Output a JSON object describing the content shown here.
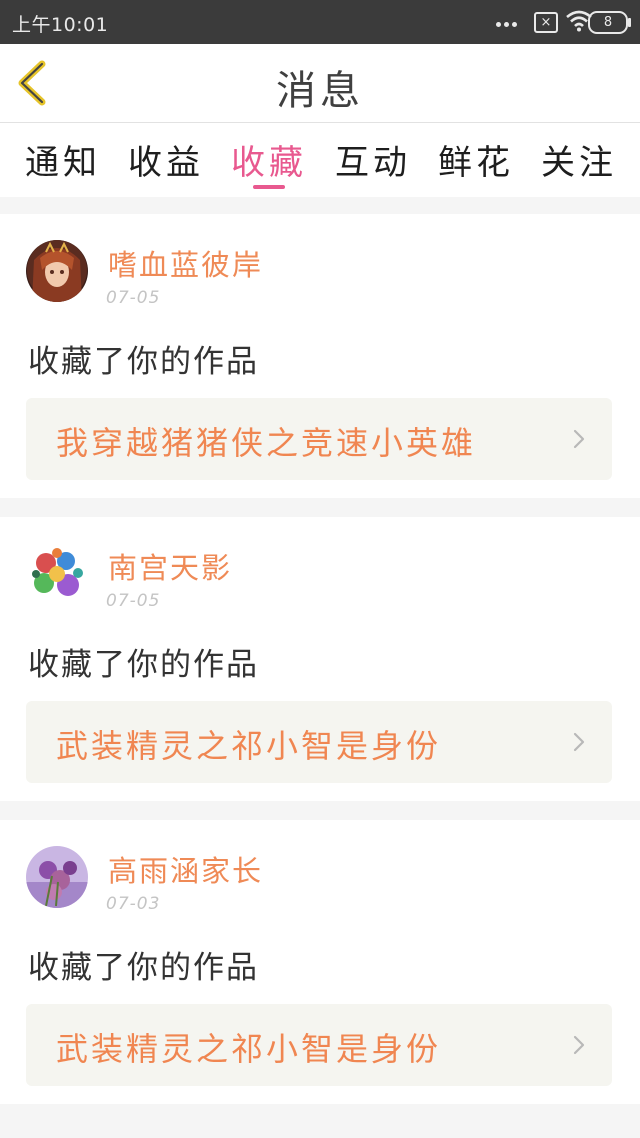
{
  "status_bar": {
    "time": "上午10:01",
    "sim_label": "×",
    "battery_level": "8"
  },
  "nav": {
    "title": "消息"
  },
  "tabs": [
    {
      "label": "通知"
    },
    {
      "label": "收益"
    },
    {
      "label": "收藏",
      "active": true
    },
    {
      "label": "互动"
    },
    {
      "label": "鲜花"
    },
    {
      "label": "关注"
    }
  ],
  "messages": [
    {
      "username": "嗜血蓝彼岸",
      "date": "07-05",
      "action": "收藏了你的作品",
      "work_title": "我穿越猪猪侠之竞速小英雄"
    },
    {
      "username": "南宫天影",
      "date": "07-05",
      "action": "收藏了你的作品",
      "work_title": "武装精灵之祁小智是身份"
    },
    {
      "username": "高雨涵家长",
      "date": "07-03",
      "action": "收藏了你的作品",
      "work_title": "武装精灵之祁小智是身份"
    }
  ],
  "colors": {
    "accent_pink": "#e8598f",
    "username_orange": "#ef8a56",
    "work_title_orange": "#f08651",
    "status_bar_bg": "#3b3b3b"
  },
  "icons": [
    "back-arrow-icon",
    "wifi-icon",
    "battery-icon",
    "sim-icon",
    "more-dots-icon",
    "chevron-right-icon"
  ]
}
